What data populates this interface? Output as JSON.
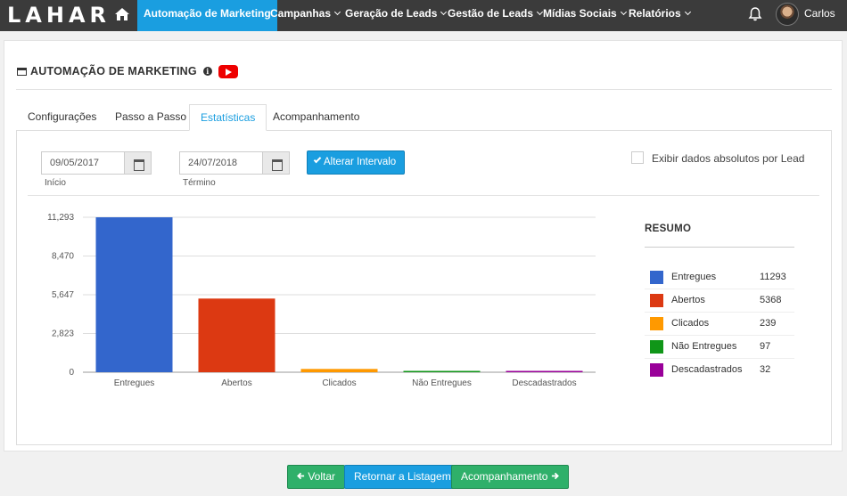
{
  "brand": {
    "logo_text": "LAHAR"
  },
  "nav": {
    "items": [
      {
        "label": "Automação de Marketing",
        "active": true,
        "dropdown": false
      },
      {
        "label": "Campanhas",
        "dropdown": true
      },
      {
        "label": "Geração de Leads",
        "dropdown": true
      },
      {
        "label": "Gestão de Leads",
        "dropdown": true
      },
      {
        "label": "Mídias Sociais",
        "dropdown": true
      },
      {
        "label": "Relatórios",
        "dropdown": true
      }
    ],
    "user_name": "Carlos"
  },
  "page": {
    "title": "AUTOMAÇÃO DE MARKETING",
    "tabs": [
      {
        "label": "Configurações"
      },
      {
        "label": "Passo a Passo"
      },
      {
        "label": "Estatísticas",
        "active": true
      },
      {
        "label": "Acompanhamento"
      }
    ]
  },
  "filters": {
    "start_date": "09/05/2017",
    "start_label": "Início",
    "end_date": "24/07/2018",
    "end_label": "Término",
    "apply_button": "Alterar Intervalo",
    "absolute_label": "Exibir dados absolutos por Lead",
    "absolute_checked": false
  },
  "chart_data": {
    "type": "bar",
    "categories": [
      "Entregues",
      "Abertos",
      "Clicados",
      "Não Entregues",
      "Descadastrados"
    ],
    "values": [
      11293,
      5368,
      239,
      97,
      32
    ],
    "colors": [
      "#3366cc",
      "#dc3912",
      "#ff9900",
      "#109618",
      "#990099"
    ],
    "ylim": [
      0,
      11293
    ],
    "yticks": [
      0,
      2823,
      5647,
      8470,
      11293
    ],
    "ytick_labels": [
      "0",
      "2,823",
      "5,647",
      "8,470",
      "11,293"
    ],
    "grid": true
  },
  "summary": {
    "title": "RESUMO",
    "rows": [
      {
        "label": "Entregues",
        "value": "11293",
        "color": "#3366cc"
      },
      {
        "label": "Abertos",
        "value": "5368",
        "color": "#dc3912"
      },
      {
        "label": "Clicados",
        "value": "239",
        "color": "#ff9900"
      },
      {
        "label": "Não Entregues",
        "value": "97",
        "color": "#109618"
      },
      {
        "label": "Descadastrados",
        "value": "32",
        "color": "#990099"
      }
    ]
  },
  "footer": {
    "back": "Voltar",
    "list": "Retornar a Listagem",
    "next": "Acompanhamento"
  }
}
